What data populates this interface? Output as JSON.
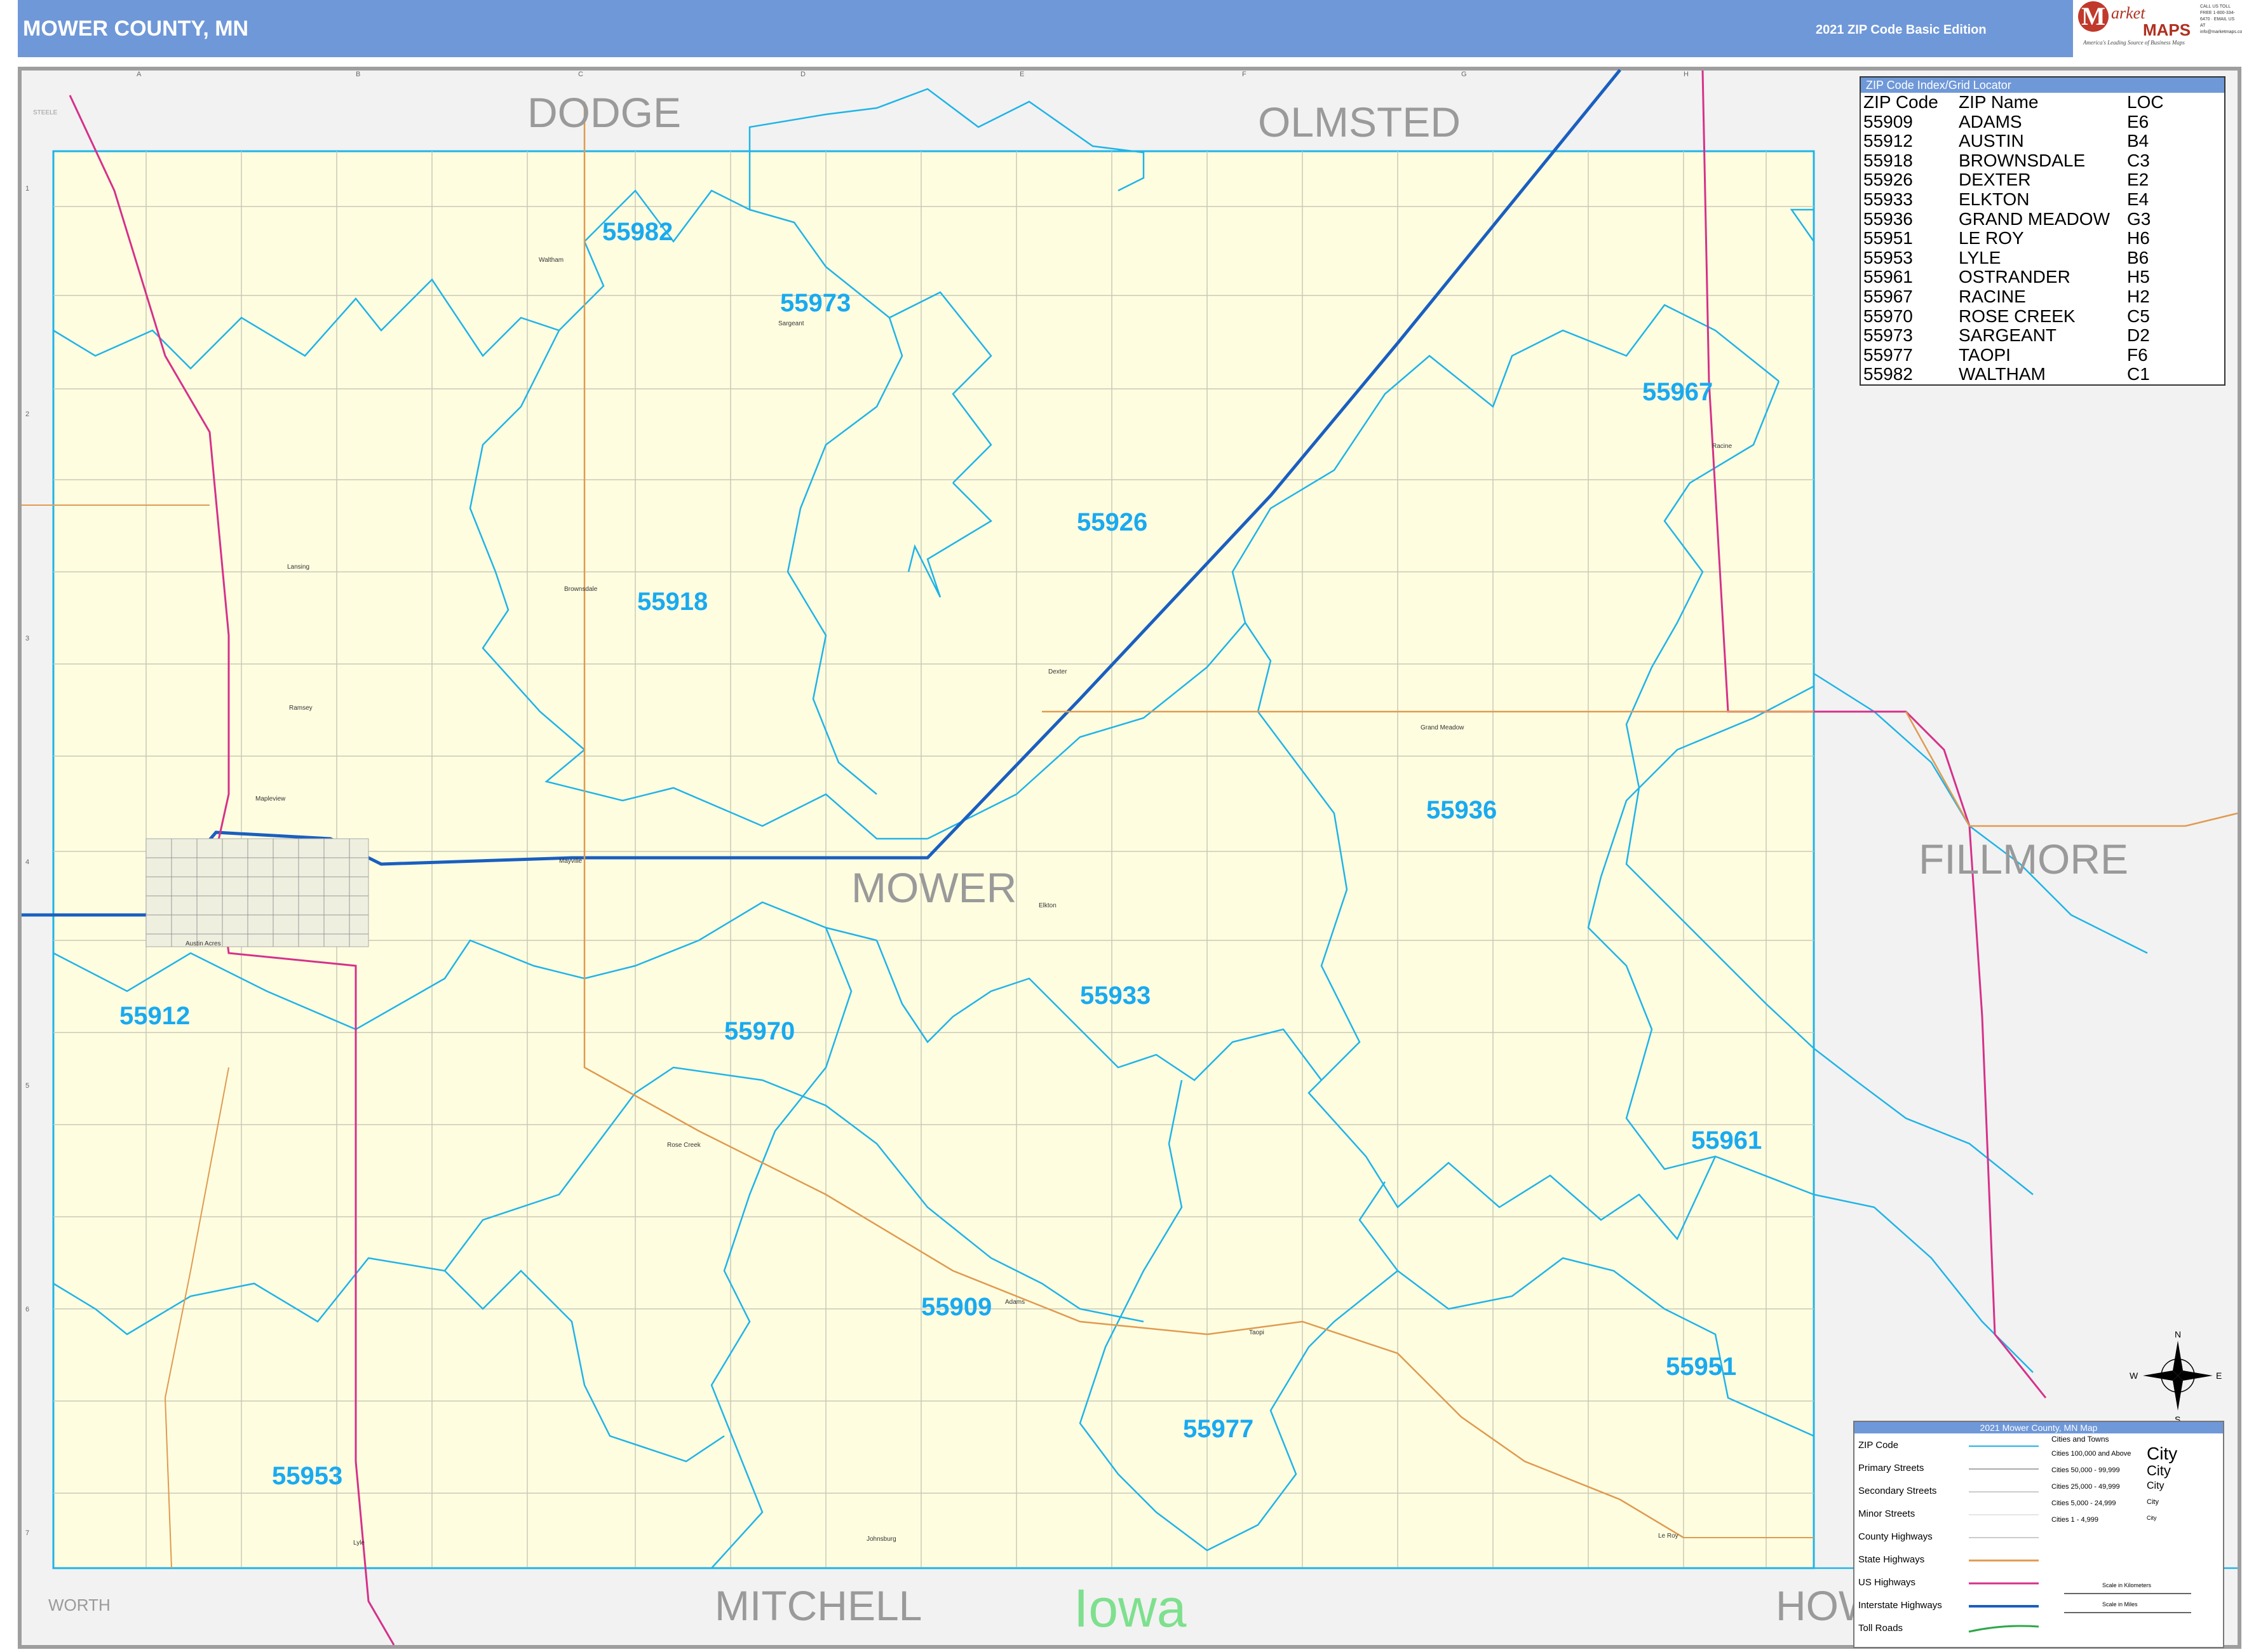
{
  "header": {
    "title": "MOWER COUNTY, MN",
    "edition": "2021 ZIP Code Basic Edition",
    "logo": {
      "mark": "M",
      "word1": "arket",
      "word2": "MAPS",
      "tagline": "America's Leading Source of Business Maps",
      "slogan": "On Target, On Time.",
      "contact": "CALL US TOLL FREE 1-800-334-6470 · EMAIL US AT info@marketmaps.com"
    }
  },
  "grid": {
    "columns": [
      "A",
      "B",
      "C",
      "D",
      "E",
      "F",
      "G",
      "H"
    ],
    "rows": [
      "1",
      "2",
      "3",
      "4",
      "5",
      "6",
      "7"
    ]
  },
  "neighbors": {
    "dodge": "DODGE",
    "olmsted": "OLMSTED",
    "fillmore": "FILLMORE",
    "mitchell": "MITCHELL",
    "howard": "HOW",
    "worth": "WORTH",
    "steele": "STEELE",
    "state": "Iowa"
  },
  "county_label": "MOWER",
  "zip_labels": {
    "z55982": "55982",
    "z55973": "55973",
    "z55967": "55967",
    "z55926": "55926",
    "z55918": "55918",
    "z55936": "55936",
    "z55912": "55912",
    "z55970": "55970",
    "z55933": "55933",
    "z55961": "55961",
    "z55909": "55909",
    "z55951": "55951",
    "z55977": "55977",
    "z55953": "55953"
  },
  "towns": {
    "waltham": "Waltham",
    "sargeant": "Sargeant",
    "racine": "Racine",
    "dexter": "Dexter",
    "brownsdale": "Brownsdale",
    "lansing": "Lansing",
    "ramsey": "Ramsey",
    "grand_meadow": "Grand Meadow",
    "mapleview": "Mapleview",
    "mayville": "Mayville",
    "elkton": "Elkton",
    "austin_acres": "Austin Acres",
    "rose_creek": "Rose Creek",
    "adams": "Adams",
    "taopi": "Taopi",
    "le_roy": "Le Roy",
    "lyle": "Lyle",
    "johnsburg": "Johnsburg"
  },
  "zip_index": {
    "title": "ZIP Code Index/Grid Locator",
    "headers": [
      "ZIP Code",
      "ZIP Name",
      "LOC"
    ],
    "rows": [
      [
        "55909",
        "ADAMS",
        "E6"
      ],
      [
        "55912",
        "AUSTIN",
        "B4"
      ],
      [
        "55918",
        "BROWNSDALE",
        "C3"
      ],
      [
        "55926",
        "DEXTER",
        "E2"
      ],
      [
        "55933",
        "ELKTON",
        "E4"
      ],
      [
        "55936",
        "GRAND MEADOW",
        "G3"
      ],
      [
        "55951",
        "LE ROY",
        "H6"
      ],
      [
        "55953",
        "LYLE",
        "B6"
      ],
      [
        "55961",
        "OSTRANDER",
        "H5"
      ],
      [
        "55967",
        "RACINE",
        "H2"
      ],
      [
        "55970",
        "ROSE CREEK",
        "C5"
      ],
      [
        "55973",
        "SARGEANT",
        "D2"
      ],
      [
        "55977",
        "TAOPI",
        "F6"
      ],
      [
        "55982",
        "WALTHAM",
        "C1"
      ]
    ]
  },
  "compass": {
    "n": "N",
    "s": "S",
    "e": "E",
    "w": "W"
  },
  "legend": {
    "title": "2021 Mower County, MN Map",
    "items": [
      "ZIP Code",
      "Primary Streets",
      "Secondary Streets",
      "Minor Streets",
      "County Highways",
      "State Highways",
      "US Highways",
      "Interstate Highways",
      "Toll Roads"
    ],
    "cities_head": "Cities and Towns",
    "cities": [
      "Cities 100,000 and Above",
      "Cities 50,000 - 99,999",
      "Cities 25,000 - 49,999",
      "Cities 5,000 - 24,999",
      "Cities 1 - 4,999"
    ],
    "city_sample": "City",
    "scale_km": "Scale in Kilometers",
    "scale_mi": "Scale in Miles"
  },
  "colors": {
    "header": "#6f98d8",
    "county_fill": "#fffde0",
    "zip_line": "#1fb4e8",
    "zip_label": "#19aaf0",
    "interstate": "#1a5fc0",
    "us_highway": "#d6318a",
    "state_highway": "#e09a50",
    "neighbor_label": "#9a9a9a",
    "iowa": "#7ee08e"
  },
  "icons": [
    "compass-rose-icon",
    "logo-icon"
  ]
}
